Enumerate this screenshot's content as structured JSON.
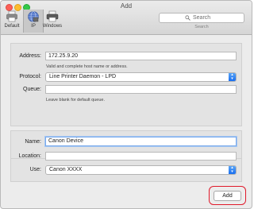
{
  "window": {
    "title": "Add"
  },
  "toolbar": {
    "items": [
      {
        "label": "Default",
        "icon": "printer-default-icon"
      },
      {
        "label": "IP",
        "icon": "globe-icon"
      },
      {
        "label": "Windows",
        "icon": "windows-printer-icon"
      }
    ],
    "selected": "IP"
  },
  "search": {
    "placeholder": "Search",
    "caption": "Search"
  },
  "form": {
    "address": {
      "label": "Address:",
      "value": "172.25.9.20",
      "help": "Valid and complete host name or address."
    },
    "protocol": {
      "label": "Protocol:",
      "value": "Line Printer Daemon - LPD"
    },
    "queue": {
      "label": "Queue:",
      "value": "",
      "help": "Leave blank for default queue."
    },
    "name": {
      "label": "Name:",
      "value": "Canon Device"
    },
    "location": {
      "label": "Location:",
      "value": ""
    },
    "use": {
      "label": "Use:",
      "value": "Canon XXXX"
    }
  },
  "actions": {
    "add_label": "Add"
  },
  "colors": {
    "close": "#fc5f57",
    "minimize": "#fdbc2e",
    "maximize": "#34c84a",
    "accent": "#1a6ff0",
    "highlight": "#e0192a"
  }
}
